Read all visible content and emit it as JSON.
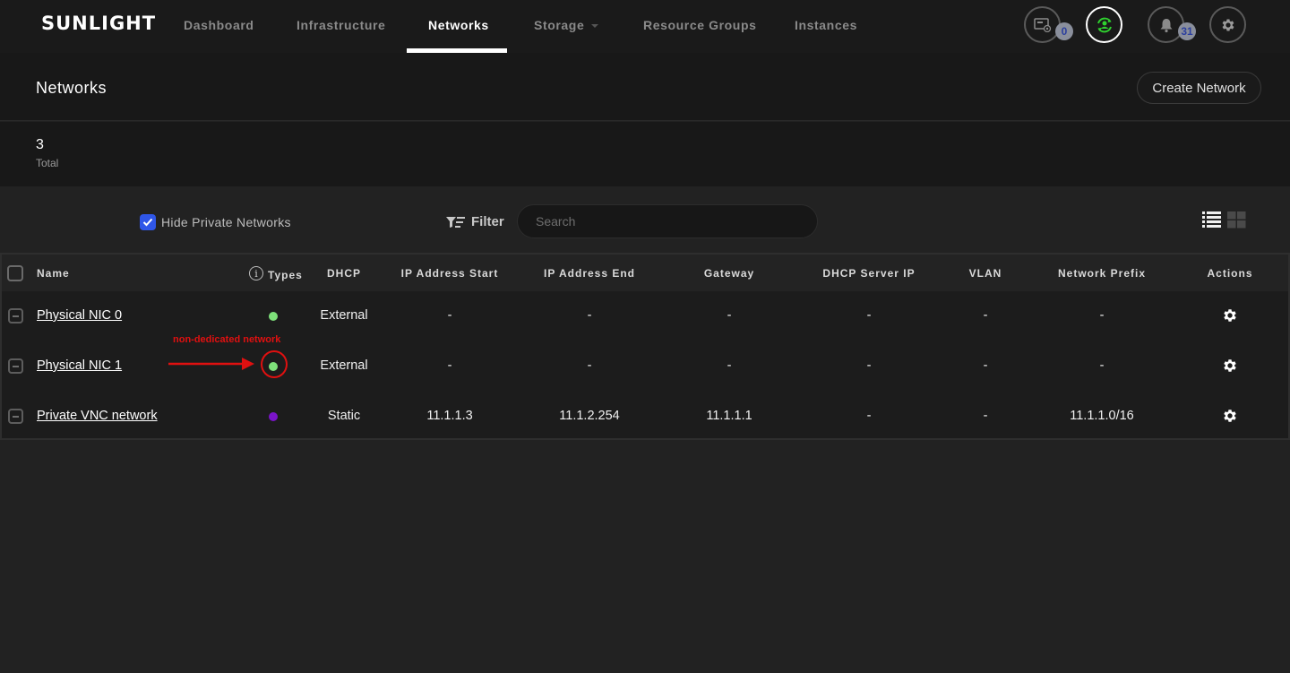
{
  "app": {
    "logo": "SUNLIGHT"
  },
  "nav": {
    "items": [
      {
        "label": "Dashboard",
        "active": false
      },
      {
        "label": "Infrastructure",
        "active": false
      },
      {
        "label": "Networks",
        "active": true
      },
      {
        "label": "Storage",
        "active": false,
        "has_dropdown": true
      },
      {
        "label": "Resource Groups",
        "active": false
      },
      {
        "label": "Instances",
        "active": false
      }
    ],
    "icons": [
      {
        "name": "sim-card-icon",
        "badge": "0"
      },
      {
        "name": "user-sync-icon",
        "active": true
      },
      {
        "name": "bell-icon",
        "badge": "31"
      },
      {
        "name": "gear-icon"
      }
    ]
  },
  "header": {
    "title": "Networks",
    "create_button": "Create Network"
  },
  "stats": {
    "total_value": "3",
    "total_label": "Total"
  },
  "toolbar": {
    "hide_private_label": "Hide Private Networks",
    "hide_private_checked": true,
    "filter_label": "Filter",
    "search_placeholder": "Search",
    "search_value": ""
  },
  "table": {
    "columns": [
      "Name",
      "Types",
      "DHCP",
      "IP Address Start",
      "IP Address End",
      "Gateway",
      "DHCP Server IP",
      "VLAN",
      "Network Prefix",
      "Actions"
    ],
    "rows": [
      {
        "name": "Physical NIC 0",
        "type_color": "#7ee07a",
        "dhcp": "External",
        "ip_start": "-",
        "ip_end": "-",
        "gateway": "-",
        "dhcp_server_ip": "-",
        "vlan": "-",
        "prefix": "-"
      },
      {
        "name": "Physical NIC 1",
        "type_color": "#7ee07a",
        "dhcp": "External",
        "ip_start": "-",
        "ip_end": "-",
        "gateway": "-",
        "dhcp_server_ip": "-",
        "vlan": "-",
        "prefix": "-"
      },
      {
        "name": "Private VNC network",
        "type_color": "#7a14c8",
        "dhcp": "Static",
        "ip_start": "11.1.1.3",
        "ip_end": "11.1.2.254",
        "gateway": "11.1.1.1",
        "dhcp_server_ip": "-",
        "vlan": "-",
        "prefix": "11.1.1.0/16"
      }
    ]
  },
  "annotation": {
    "text": "non-dedicated network",
    "color": "#e01010"
  },
  "colors": {
    "accent_blue": "#2f56e8",
    "active_green": "#2fd12f",
    "badge_text": "#2b3f9e"
  }
}
